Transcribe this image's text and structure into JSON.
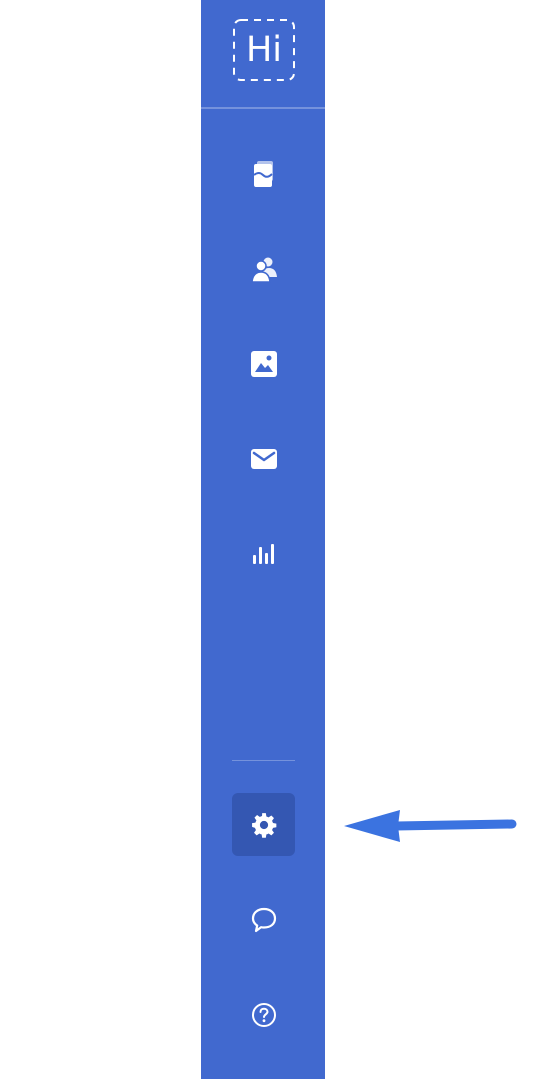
{
  "app": {
    "logo_text": "Hi"
  },
  "sidebar": {
    "background": "#4169cf",
    "active_background": "#3457b2",
    "items": [
      {
        "id": "pages",
        "icon": "document-icon",
        "active": false
      },
      {
        "id": "contacts",
        "icon": "users-icon",
        "active": false
      },
      {
        "id": "media",
        "icon": "image-icon",
        "active": false
      },
      {
        "id": "email",
        "icon": "mail-icon",
        "active": false
      },
      {
        "id": "analytics",
        "icon": "chart-icon",
        "active": false
      }
    ],
    "bottom_items": [
      {
        "id": "settings",
        "icon": "gear-icon",
        "active": true
      },
      {
        "id": "feedback",
        "icon": "chat-bubble-icon",
        "active": false
      },
      {
        "id": "help",
        "icon": "help-icon",
        "active": false
      }
    ]
  },
  "annotation": {
    "arrow_color": "#3b73e0",
    "points_to": "settings"
  }
}
